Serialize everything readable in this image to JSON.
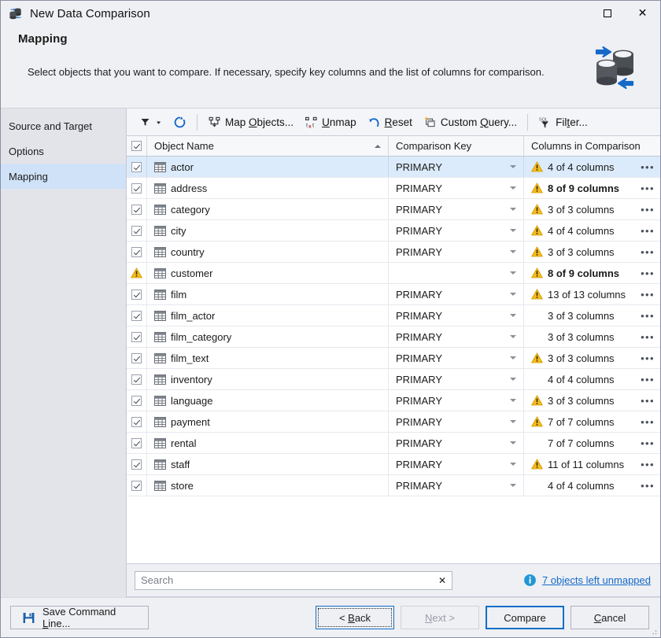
{
  "window": {
    "title": "New Data Comparison",
    "title_icon": "databases-sync-icon",
    "maximize_label": "",
    "close_label": "✕"
  },
  "header": {
    "heading": "Mapping",
    "description": "Select objects that you want to compare. If necessary, specify key columns and the list of columns for comparison.",
    "icon": "databases-sync-icon"
  },
  "sidebar": {
    "items": [
      {
        "label": "Source and Target",
        "active": false
      },
      {
        "label": "Options",
        "active": false
      },
      {
        "label": "Mapping",
        "active": true
      }
    ]
  },
  "toolbar": {
    "filter_dropdown": {
      "icon": "funnel-icon",
      "label": ""
    },
    "refresh": {
      "icon": "refresh-icon",
      "label": ""
    },
    "items": [
      {
        "icon": "map-objects-icon",
        "label": "Map Objects...",
        "accel": "O"
      },
      {
        "icon": "unmap-icon",
        "label": "Unmap",
        "accel": "U"
      },
      {
        "icon": "reset-icon",
        "label": "Reset",
        "accel": "R"
      },
      {
        "icon": "custom-query-icon",
        "label": "Custom Query...",
        "accel": "Q"
      },
      {
        "icon": "sql-filter-icon",
        "label": "Filter...",
        "accel": "t"
      }
    ]
  },
  "grid": {
    "columns": [
      {
        "key": "check",
        "label": ""
      },
      {
        "key": "name",
        "label": "Object Name",
        "sorted": "asc"
      },
      {
        "key": "comparison_key",
        "label": "Comparison Key"
      },
      {
        "key": "columns_in_comparison",
        "label": "Columns in Comparison"
      }
    ],
    "rows": [
      {
        "checked": true,
        "warning_row": false,
        "name": "actor",
        "comparison_key": "PRIMARY",
        "columns": "4 of 4 columns",
        "columns_warning": true,
        "columns_bold": false,
        "selected": true
      },
      {
        "checked": true,
        "warning_row": false,
        "name": "address",
        "comparison_key": "PRIMARY",
        "columns": "8 of 9 columns",
        "columns_warning": true,
        "columns_bold": true,
        "selected": false
      },
      {
        "checked": true,
        "warning_row": false,
        "name": "category",
        "comparison_key": "PRIMARY",
        "columns": "3 of 3 columns",
        "columns_warning": true,
        "columns_bold": false,
        "selected": false
      },
      {
        "checked": true,
        "warning_row": false,
        "name": "city",
        "comparison_key": "PRIMARY",
        "columns": "4 of 4 columns",
        "columns_warning": true,
        "columns_bold": false,
        "selected": false
      },
      {
        "checked": true,
        "warning_row": false,
        "name": "country",
        "comparison_key": "PRIMARY",
        "columns": "3 of 3 columns",
        "columns_warning": true,
        "columns_bold": false,
        "selected": false
      },
      {
        "checked": false,
        "warning_row": true,
        "name": "customer",
        "comparison_key": "",
        "columns": "8 of 9 columns",
        "columns_warning": true,
        "columns_bold": true,
        "selected": false
      },
      {
        "checked": true,
        "warning_row": false,
        "name": "film",
        "comparison_key": "PRIMARY",
        "columns": "13 of 13 columns",
        "columns_warning": true,
        "columns_bold": false,
        "selected": false
      },
      {
        "checked": true,
        "warning_row": false,
        "name": "film_actor",
        "comparison_key": "PRIMARY",
        "columns": "3 of 3 columns",
        "columns_warning": false,
        "columns_bold": false,
        "selected": false
      },
      {
        "checked": true,
        "warning_row": false,
        "name": "film_category",
        "comparison_key": "PRIMARY",
        "columns": "3 of 3 columns",
        "columns_warning": false,
        "columns_bold": false,
        "selected": false
      },
      {
        "checked": true,
        "warning_row": false,
        "name": "film_text",
        "comparison_key": "PRIMARY",
        "columns": "3 of 3 columns",
        "columns_warning": true,
        "columns_bold": false,
        "selected": false
      },
      {
        "checked": true,
        "warning_row": false,
        "name": "inventory",
        "comparison_key": "PRIMARY",
        "columns": "4 of 4 columns",
        "columns_warning": false,
        "columns_bold": false,
        "selected": false
      },
      {
        "checked": true,
        "warning_row": false,
        "name": "language",
        "comparison_key": "PRIMARY",
        "columns": "3 of 3 columns",
        "columns_warning": true,
        "columns_bold": false,
        "selected": false
      },
      {
        "checked": true,
        "warning_row": false,
        "name": "payment",
        "comparison_key": "PRIMARY",
        "columns": "7 of 7 columns",
        "columns_warning": true,
        "columns_bold": false,
        "selected": false
      },
      {
        "checked": true,
        "warning_row": false,
        "name": "rental",
        "comparison_key": "PRIMARY",
        "columns": "7 of 7 columns",
        "columns_warning": false,
        "columns_bold": false,
        "selected": false
      },
      {
        "checked": true,
        "warning_row": false,
        "name": "staff",
        "comparison_key": "PRIMARY",
        "columns": "11 of 11 columns",
        "columns_warning": true,
        "columns_bold": false,
        "selected": false
      },
      {
        "checked": true,
        "warning_row": false,
        "name": "store",
        "comparison_key": "PRIMARY",
        "columns": "4 of 4 columns",
        "columns_warning": false,
        "columns_bold": false,
        "selected": false
      }
    ],
    "row_menu_label": "•••"
  },
  "search": {
    "value": "",
    "placeholder": "Search",
    "clear_label": "✕"
  },
  "status": {
    "info_icon": "info-icon",
    "unmapped_link": "7 objects left unmapped"
  },
  "footer": {
    "save_command_line": "Save Command Line...",
    "save_command_line_accel": "L",
    "back": "< Back",
    "back_accel": "B",
    "next": "Next >",
    "next_accel": "N",
    "compare": "Compare",
    "cancel": "Cancel",
    "cancel_accel": "C"
  },
  "colors": {
    "accent": "#0f6fc5",
    "link": "#1569c7",
    "selection": "#dcebfb",
    "sidebar_active": "#cfe2f7",
    "warning": "#f5bc1c",
    "window_bg": "#eff0f4"
  }
}
